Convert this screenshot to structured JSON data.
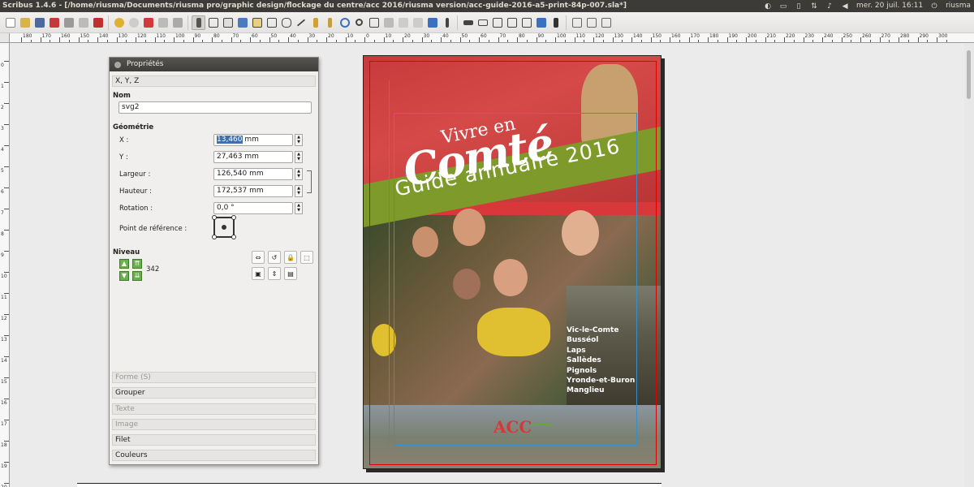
{
  "window": {
    "title": "Scribus 1.4.6 - [/home/riusma/Documents/riusma pro/graphic design/flockage du centre/acc 2016/riusma version/acc-guide-2016-a5-print-84p-007.sla*]",
    "clock": "mer. 20 juil. 16:11",
    "user": "riusma"
  },
  "toolbar": {
    "icons": [
      "new-icon",
      "open-icon",
      "save-icon",
      "close-icon",
      "print-icon",
      "preflight-icon",
      "pdf-icon",
      "undo-icon",
      "redo-icon",
      "cut-icon",
      "copy-icon",
      "paste-icon",
      "select-icon",
      "text-frame-icon",
      "image-frame-icon",
      "render-frame-icon",
      "table-icon",
      "shape-icon",
      "polygon-icon",
      "line-icon",
      "bezier-icon",
      "freehand-icon",
      "rotate-icon",
      "zoom-icon",
      "edit-text-icon",
      "link-frames-icon",
      "unlink-frames-icon",
      "measure-icon",
      "copy-props-icon",
      "eyedropper-icon",
      "pdf-button-icon",
      "pdf-textfield-icon",
      "pdf-checkbox-icon",
      "pdf-combobox-icon",
      "pdf-listbox-icon",
      "pdf-annotation-icon",
      "pdf-link-icon"
    ]
  },
  "hruler": {
    "labels": [
      "180",
      "170",
      "160",
      "150",
      "140",
      "130",
      "120",
      "110",
      "100",
      "90",
      "80",
      "70",
      "60",
      "50",
      "40",
      "30",
      "20",
      "10",
      "0",
      "10",
      "20",
      "30",
      "40",
      "50",
      "60",
      "70",
      "80",
      "90",
      "100",
      "110",
      "120",
      "130",
      "140",
      "150",
      "160",
      "170",
      "180",
      "190",
      "200",
      "210",
      "220",
      "230",
      "240",
      "250",
      "260",
      "270",
      "280",
      "290",
      "300"
    ]
  },
  "vruler": {
    "labels": [
      "0",
      "1",
      "2",
      "3",
      "4",
      "5",
      "6",
      "7",
      "8",
      "9",
      "10",
      "11",
      "12",
      "13",
      "14",
      "15",
      "16",
      "17",
      "18",
      "19",
      "20"
    ]
  },
  "properties": {
    "title": "Propriétés",
    "xyz_section": "X, Y, Z",
    "name_label": "Nom",
    "name_value": "svg2",
    "geometry_label": "Géométrie",
    "x_label": "X :",
    "x_value_sel": "13,460",
    "x_unit": " mm",
    "y_label": "Y :",
    "y_value": "27,463 mm",
    "width_label": "Largeur :",
    "width_value": "126,540 mm",
    "height_label": "Hauteur :",
    "height_value": "172,537 mm",
    "rotation_label": "Rotation :",
    "rotation_value": "0,0 °",
    "refpoint_label": "Point de référence :",
    "level_label": "Niveau",
    "level_value": "342",
    "sections": [
      {
        "label": "Forme (S)",
        "enabled": false
      },
      {
        "label": "Grouper",
        "enabled": true
      },
      {
        "label": "Texte",
        "enabled": false
      },
      {
        "label": "Image",
        "enabled": false
      },
      {
        "label": "Filet",
        "enabled": true
      },
      {
        "label": "Couleurs",
        "enabled": true
      }
    ]
  },
  "cover": {
    "title_a": "Vivre en",
    "title_b": "Comté",
    "subtitle": "Guide annuaire 2016",
    "towns": [
      "Vic-le-Comte",
      "Busséol",
      "Laps",
      "Sallèdes",
      "Pignols",
      "Yronde-et-Buron",
      "Manglieu"
    ],
    "logo": "ACC"
  }
}
